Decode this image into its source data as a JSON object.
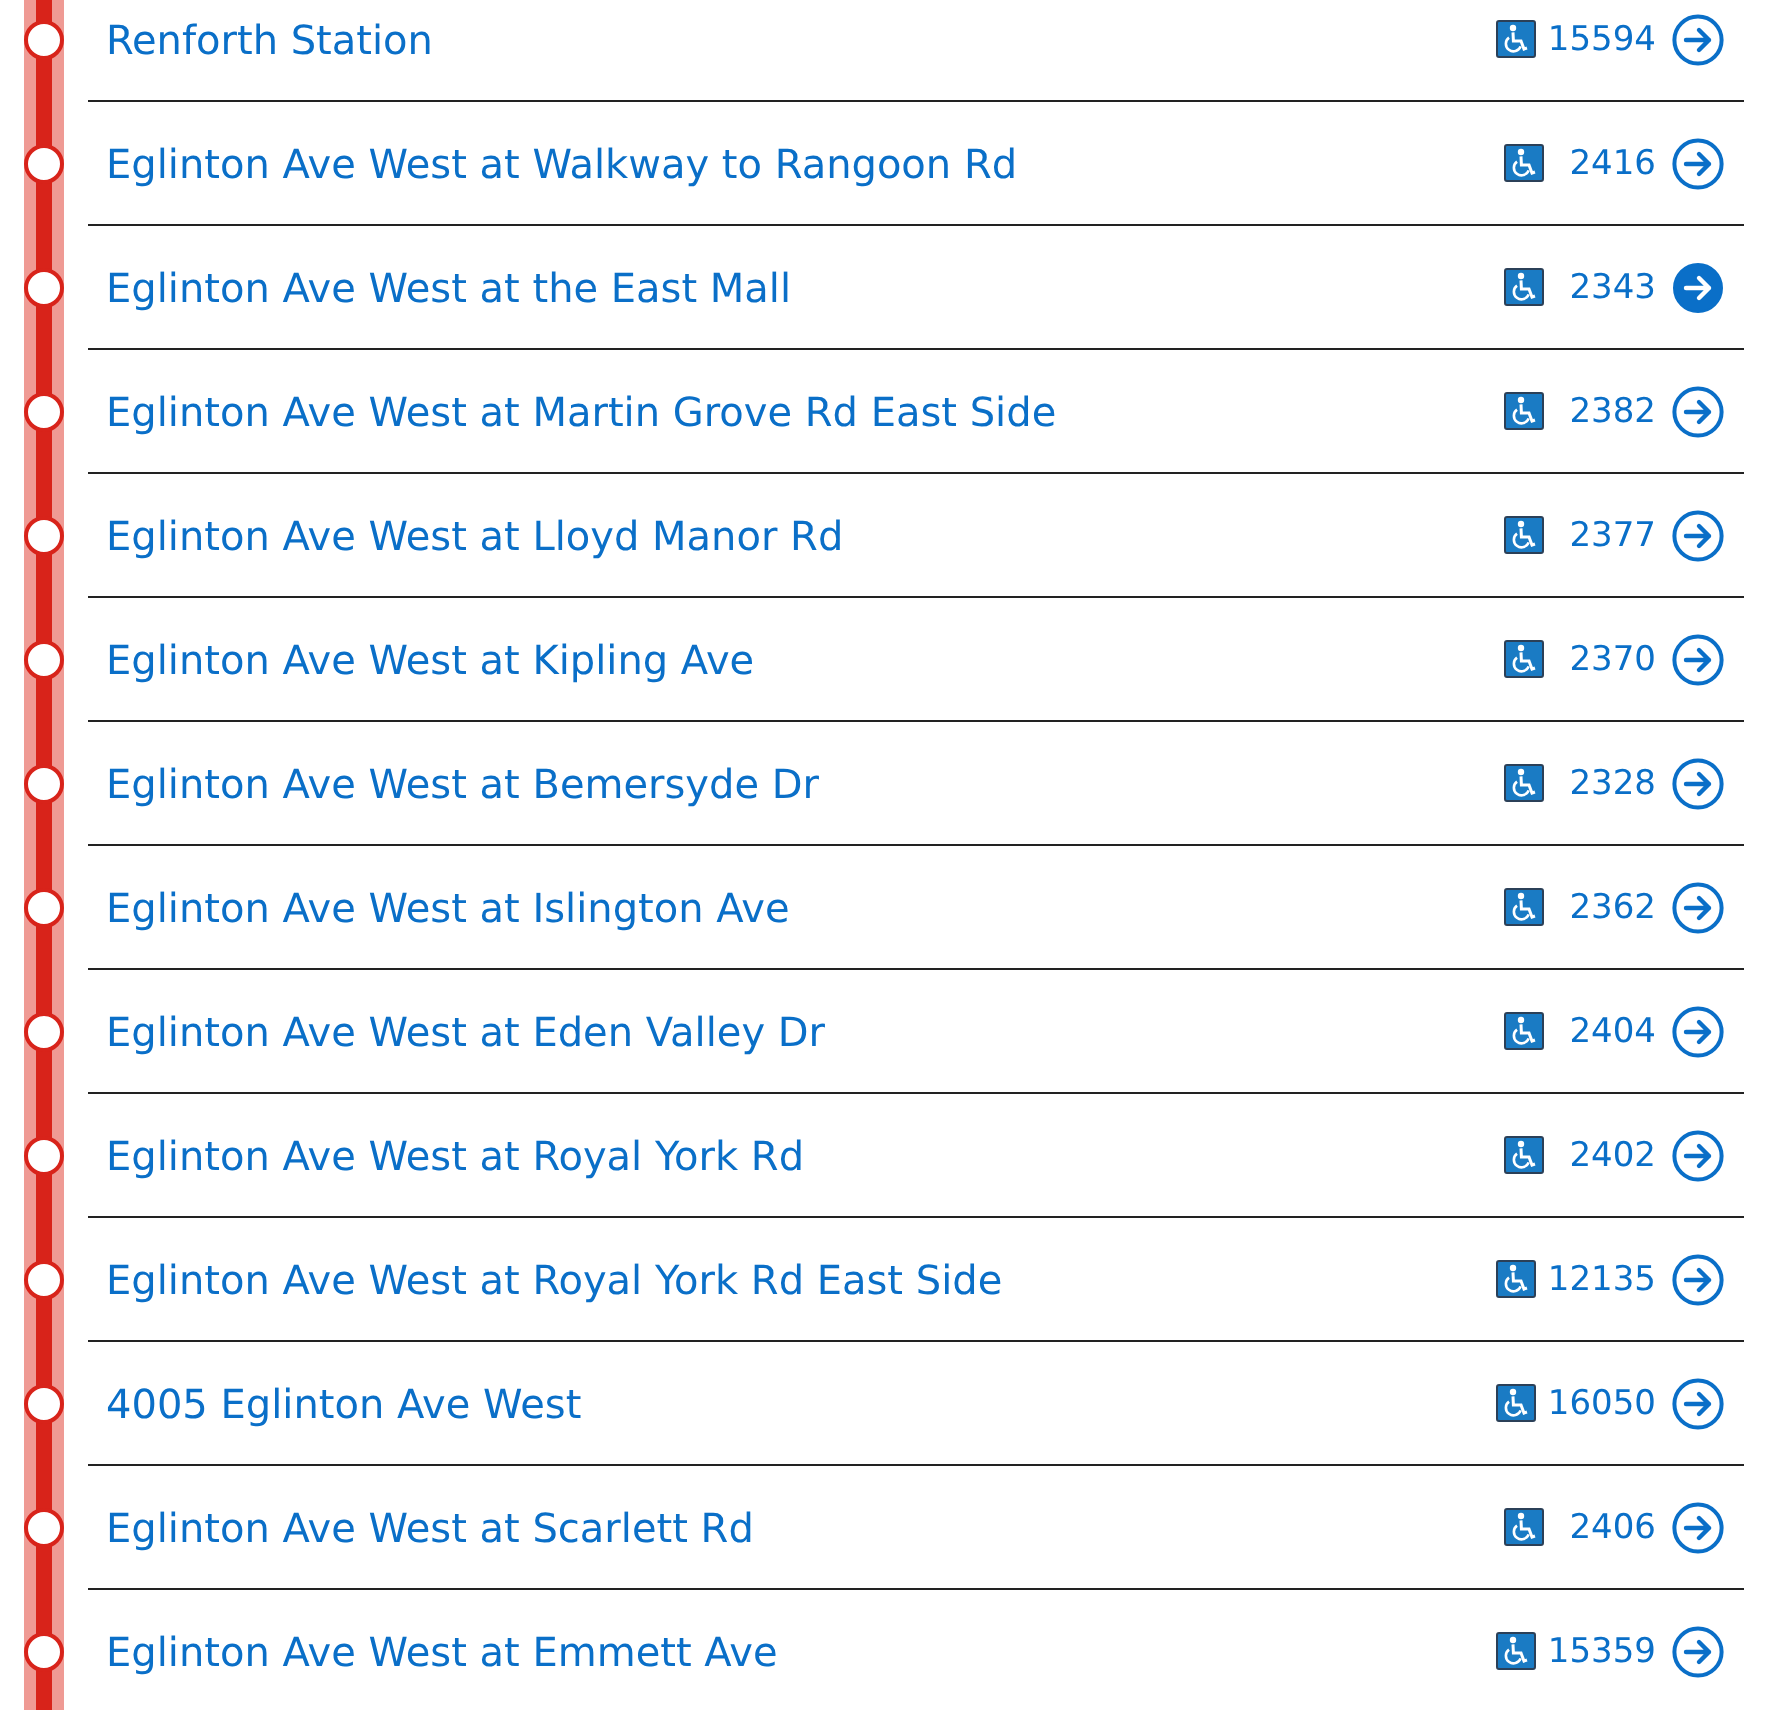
{
  "route_stops": [
    {
      "name": "Renforth Station",
      "stop_code": "15594",
      "accessible": true,
      "selected": false
    },
    {
      "name": "Eglinton Ave West at Walkway to Rangoon Rd",
      "stop_code": "2416",
      "accessible": true,
      "selected": false
    },
    {
      "name": "Eglinton Ave West at the East Mall",
      "stop_code": "2343",
      "accessible": true,
      "selected": true
    },
    {
      "name": "Eglinton Ave West at Martin Grove Rd East Side",
      "stop_code": "2382",
      "accessible": true,
      "selected": false
    },
    {
      "name": "Eglinton Ave West at Lloyd Manor Rd",
      "stop_code": "2377",
      "accessible": true,
      "selected": false
    },
    {
      "name": "Eglinton Ave West at Kipling Ave",
      "stop_code": "2370",
      "accessible": true,
      "selected": false
    },
    {
      "name": "Eglinton Ave West at Bemersyde Dr",
      "stop_code": "2328",
      "accessible": true,
      "selected": false
    },
    {
      "name": "Eglinton Ave West at Islington Ave",
      "stop_code": "2362",
      "accessible": true,
      "selected": false
    },
    {
      "name": "Eglinton Ave West at Eden Valley Dr",
      "stop_code": "2404",
      "accessible": true,
      "selected": false
    },
    {
      "name": "Eglinton Ave West at Royal York Rd",
      "stop_code": "2402",
      "accessible": true,
      "selected": false
    },
    {
      "name": "Eglinton Ave West at Royal York Rd East Side",
      "stop_code": "12135",
      "accessible": true,
      "selected": false
    },
    {
      "name": "4005 Eglinton Ave West",
      "stop_code": "16050",
      "accessible": true,
      "selected": false
    },
    {
      "name": "Eglinton Ave West at Scarlett Rd",
      "stop_code": "2406",
      "accessible": true,
      "selected": false
    },
    {
      "name": "Eglinton Ave West at Emmett Ave",
      "stop_code": "15359",
      "accessible": true,
      "selected": false
    }
  ]
}
